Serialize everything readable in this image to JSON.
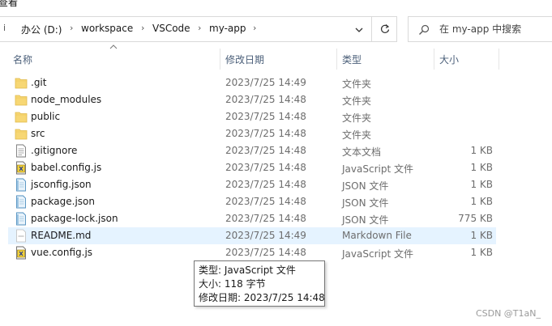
{
  "window": {
    "title_fragment": "查看"
  },
  "address_bar": {
    "crumbs": [
      "办公 (D:)",
      "workspace",
      "VSCode",
      "my-app"
    ]
  },
  "search": {
    "placeholder": "在 my-app 中搜索"
  },
  "columns": {
    "name": "名称",
    "date": "修改日期",
    "type": "类型",
    "size": "大小"
  },
  "files": [
    {
      "name": ".git",
      "date": "2023/7/25 14:49",
      "type": "文件夹",
      "size": "",
      "icon": "folder-icon"
    },
    {
      "name": "node_modules",
      "date": "2023/7/25 14:48",
      "type": "文件夹",
      "size": "",
      "icon": "folder-icon"
    },
    {
      "name": "public",
      "date": "2023/7/25 14:48",
      "type": "文件夹",
      "size": "",
      "icon": "folder-icon"
    },
    {
      "name": "src",
      "date": "2023/7/25 14:48",
      "type": "文件夹",
      "size": "",
      "icon": "folder-icon"
    },
    {
      "name": ".gitignore",
      "date": "2023/7/25 14:48",
      "type": "文本文档",
      "size": "1 KB",
      "icon": "text-document-icon"
    },
    {
      "name": "babel.config.js",
      "date": "2023/7/25 14:48",
      "type": "JavaScript 文件",
      "size": "1 KB",
      "icon": "javascript-file-icon"
    },
    {
      "name": "jsconfig.json",
      "date": "2023/7/25 14:48",
      "type": "JSON 文件",
      "size": "1 KB",
      "icon": "json-file-icon"
    },
    {
      "name": "package.json",
      "date": "2023/7/25 14:48",
      "type": "JSON 文件",
      "size": "1 KB",
      "icon": "json-file-icon"
    },
    {
      "name": "package-lock.json",
      "date": "2023/7/25 14:48",
      "type": "JSON 文件",
      "size": "775 KB",
      "icon": "json-file-icon"
    },
    {
      "name": "README.md",
      "date": "2023/7/25 14:49",
      "type": "Markdown File",
      "size": "1 KB",
      "icon": "markdown-file-icon"
    },
    {
      "name": "vue.config.js",
      "date": "2023/7/25 14:48",
      "type": "JavaScript 文件",
      "size": "1 KB",
      "icon": "javascript-file-icon"
    }
  ],
  "tooltip": {
    "type_line": "类型: JavaScript 文件",
    "size_line": "大小: 118 字节",
    "date_line": "修改日期: 2023/7/25 14:48"
  },
  "watermark": "CSDN @T1aN_",
  "colors": {
    "folder": "#f7d774",
    "hover_row": "#e5f3ff",
    "header_text": "#4c607a"
  }
}
